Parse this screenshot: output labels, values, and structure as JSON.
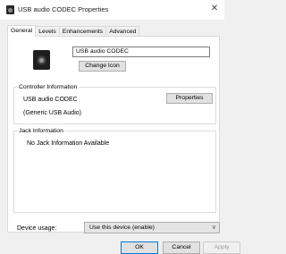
{
  "window": {
    "title": "USB audio CODEC Properties",
    "close_glyph": "✕"
  },
  "tabs": [
    {
      "label": "General",
      "active": true
    },
    {
      "label": "Levels",
      "active": false
    },
    {
      "label": "Enhancements",
      "active": false
    },
    {
      "label": "Advanced",
      "active": false
    }
  ],
  "general": {
    "device_name": "USB audio CODEC",
    "change_icon_label": "Change Icon",
    "controller_group_label": "Controller Information",
    "controller_name": "USB audio CODEC",
    "controller_sub": "(Generic USB Audio)",
    "properties_label": "Properties",
    "jack_group_label": "Jack Information",
    "jack_text": "No Jack Information Available",
    "device_usage_label": "Device usage:",
    "device_usage_value": "Use this device (enable)",
    "device_usage_chevron": "∨"
  },
  "footer": {
    "ok_label": "OK",
    "cancel_label": "Cancel",
    "apply_label": "Apply"
  }
}
